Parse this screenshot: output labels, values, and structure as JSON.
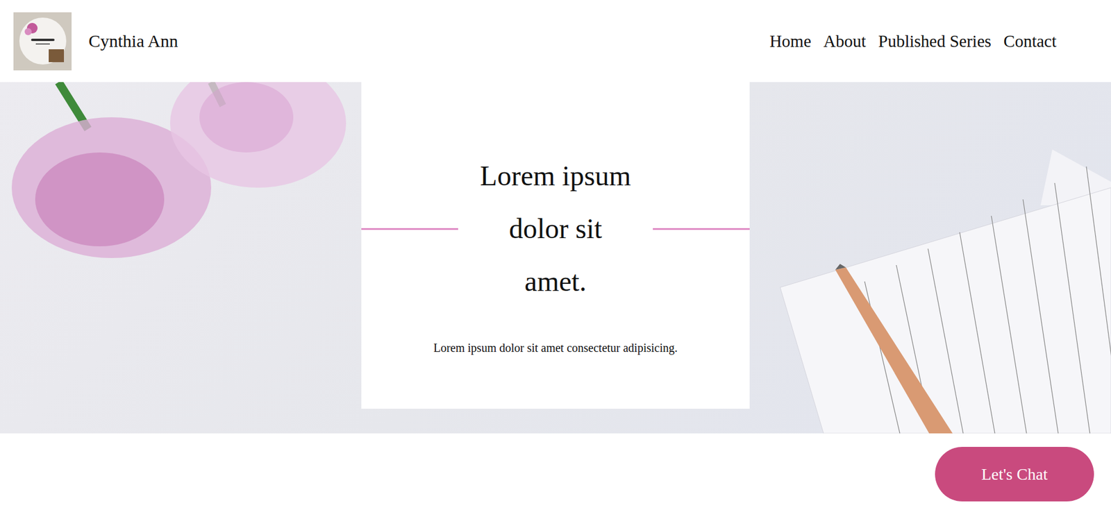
{
  "header": {
    "brand": "Cynthia Ann",
    "nav": [
      "Home",
      "About",
      "Published Series",
      "Contact"
    ]
  },
  "hero": {
    "title_lines": [
      "Lorem ipsum",
      "dolor sit",
      "amet."
    ],
    "subtitle": "Lorem ipsum dolor sit amet consectetur adipisicing."
  },
  "chat_button": "Let's Chat"
}
